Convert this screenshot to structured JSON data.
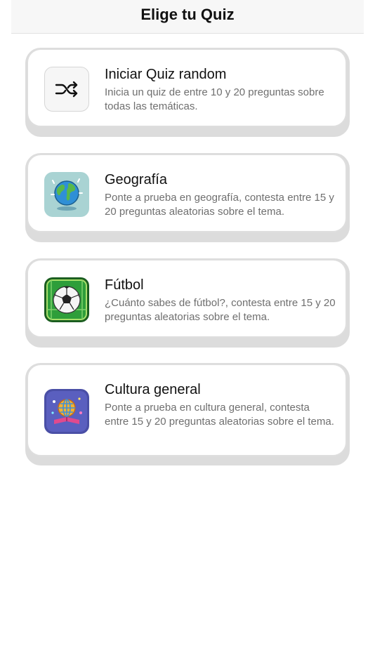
{
  "header": {
    "title": "Elige tu Quiz"
  },
  "quizzes": [
    {
      "title": "Iniciar Quiz random",
      "description": "Inicia un quiz de entre 10 y 20 preguntas sobre todas las temáticas.",
      "icon": "shuffle-icon"
    },
    {
      "title": "Geografía",
      "description": "Ponte a prueba en geografía, contesta entre 15 y 20 preguntas aleatorias sobre el tema.",
      "icon": "globe-icon"
    },
    {
      "title": "Fútbol",
      "description": "¿Cuánto sabes de fútbol?, contesta entre 15 y 20 preguntas aleatorias sobre el tema.",
      "icon": "soccer-ball-icon"
    },
    {
      "title": "Cultura general",
      "description": "Ponte a prueba en cultura general, contesta entre 15 y 20 preguntas aleatorias sobre el tema.",
      "icon": "culture-globe-icon"
    }
  ]
}
